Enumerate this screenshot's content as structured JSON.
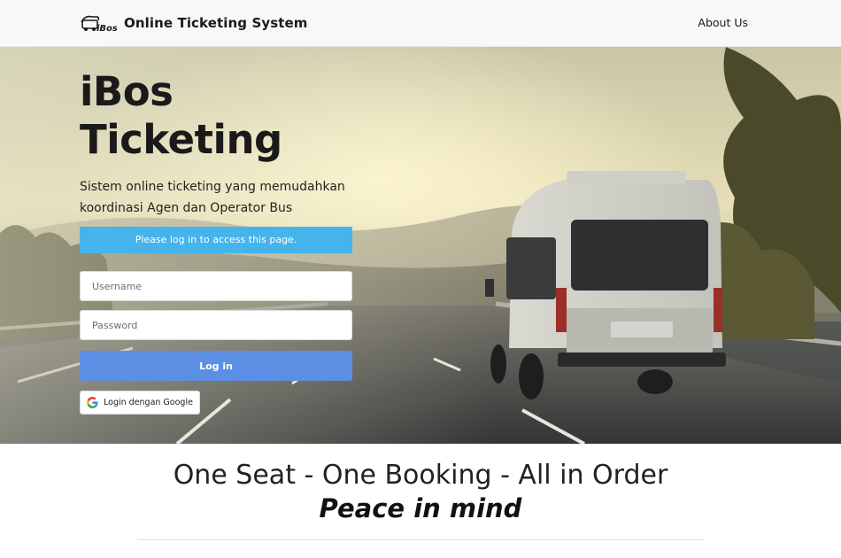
{
  "navbar": {
    "logo_text": "iBos",
    "title": "Online Ticketing System",
    "about_label": "About Us"
  },
  "hero": {
    "title_line1": "iBos",
    "title_line2": "Ticketing",
    "subtitle": "Sistem online ticketing yang memudahkan koordinasi Agen dan Operator Bus",
    "alert": "Please log in to access this page."
  },
  "login_form": {
    "username_placeholder": "Username",
    "username_value": "",
    "password_placeholder": "Password",
    "password_value": "",
    "login_label": "Log in",
    "google_label": "Login dengan Google"
  },
  "tagline": {
    "main": "One Seat - One Booking - All in Order",
    "sub": "Peace in mind"
  },
  "colors": {
    "alert_bg": "#46b4ec",
    "login_button": "#5b8fe3",
    "navbar_bg": "#f8f8f8"
  },
  "icons": [
    "ibos-logo-icon",
    "google-icon"
  ]
}
